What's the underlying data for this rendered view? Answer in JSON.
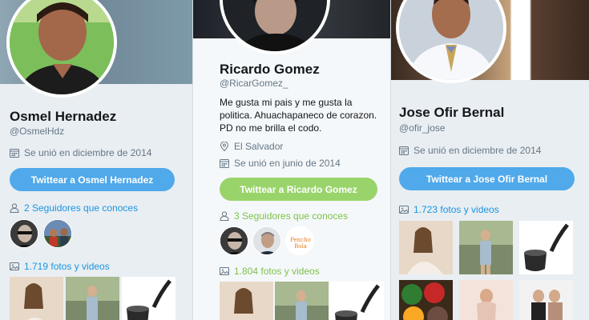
{
  "profiles": [
    {
      "name": "Osmel Hernadez",
      "handle": "@OsmelHdz",
      "joined": "Se unió en diciembre de 2014",
      "tweet_button": "Twittear a Osmel Hernadez",
      "followers_you_know": "2 Seguidores que conoces",
      "media": "1.719 fotos y videos",
      "accent": "#50a9ea"
    },
    {
      "name": "Ricardo Gomez",
      "handle": "@RicarGomez_",
      "bio": "Me gusta mi pais y me gusta la politica. Ahuachapaneco de corazon. PD no me brilla el codo.",
      "location": "El Salvador",
      "joined": "Se unió en junio de 2014",
      "tweet_button": "Twittear a Ricardo Gomez",
      "followers_you_know": "3 Seguidores que conoces",
      "follower_badge": "Pencho Bola",
      "media": "1.804 fotos y videos",
      "accent": "#99d46b"
    },
    {
      "name": "Jose Ofir Bernal",
      "handle": "@ofir_jose",
      "joined": "Se unió en diciembre de 2014",
      "tweet_button": "Twittear a Jose Ofir Bernal",
      "media": "1.723 fotos y videos",
      "accent": "#50a9ea"
    }
  ],
  "icons": {
    "calendar": "calendar-icon",
    "location": "location-pin-icon",
    "followers": "user-icon",
    "media": "image-icon"
  }
}
